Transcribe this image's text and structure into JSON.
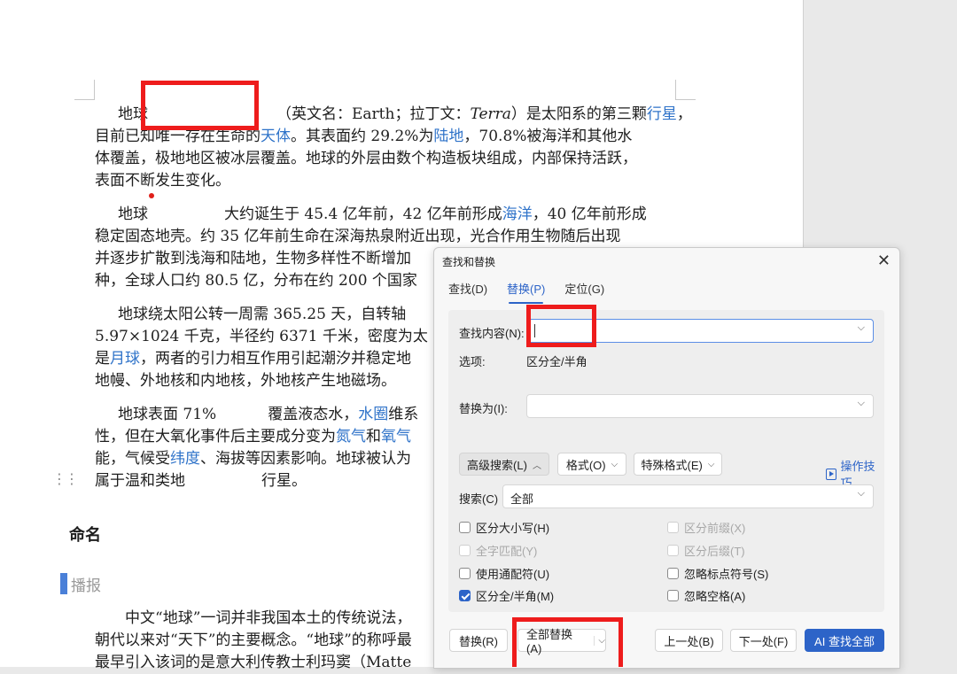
{
  "document": {
    "para1": [
      {
        "pre": "地球",
        "mid": "（英文名：Earth；拉丁文：",
        "italic": "Terra",
        "post": "）是太阳系的第三颗",
        "link": "行星",
        "end": "，"
      },
      {
        "a": "目前已知唯一存在生命的",
        "link": "天体",
        "b": "。其表面约 29.2%为",
        "link2": "陆地",
        "c": "，70.8%被海洋和其他水"
      },
      {
        "text": "体覆盖，极地地区被冰层覆盖。地球的外层由数个构造板块组成，内部保持活跃，"
      },
      {
        "text": "表面不断发生变化。"
      }
    ],
    "para2": [
      {
        "pre": "地球",
        "a": "大约诞生于 45.4 亿年前，42 亿年前形成",
        "link": "海洋",
        "b": "，40 亿年前形成"
      },
      {
        "text": "稳定固态地壳。约 35 亿年前生命在深海热泉附近出现，光合作用生物随后出现"
      },
      {
        "text": "并逐步扩散到浅海和陆地，生物多样性不断增加"
      },
      {
        "text": "种，全球人口约 80.5 亿，分布在约 200 个国家"
      }
    ],
    "para3": [
      {
        "text": "地球绕太阳公转一周需 365.25 天，自转轴"
      },
      {
        "text": "5.97×1024 千克，半径约 6371 千米，密度为太"
      },
      {
        "a": "是",
        "link": "月球",
        "b": "，两者的引力相互作用引起潮汐并稳定地"
      },
      {
        "text": "地幔、外地核和内地核，外地核产生地磁场。"
      }
    ],
    "para4": [
      {
        "a": "地球表面 71%",
        "b": "覆盖液态水，",
        "link": "水圈",
        "c": "维系"
      },
      {
        "a": "性，但在大氧化事件后主要成分变为",
        "link": "氮气",
        "b": "和",
        "link2": "氧气"
      },
      {
        "a": "能，气候受",
        "link": "纬度",
        "b": "、海拔等因素影响。地球被认为"
      },
      {
        "a": "属于温和类地",
        "b": "行星。"
      }
    ],
    "heading": "命名",
    "broadcast": "播报",
    "para5": [
      {
        "text": "中文“地球”一词并非我国本土的传统说法，"
      },
      {
        "text": "朝代以来对“天下”的主要概念。“地球”的称呼最"
      },
      {
        "text": "最早引入该词的是意大利传教士利玛窦（Matte"
      }
    ]
  },
  "dialog": {
    "title": "查找和替换",
    "close": "✕",
    "tabs": [
      {
        "label": "查找(D)"
      },
      {
        "label": "替换(P)"
      },
      {
        "label": "定位(G)"
      }
    ],
    "find_label": "查找内容(N):",
    "find_value": "",
    "options_label": "选项:",
    "options_value": "区分全/半角",
    "replace_label": "替换为(I):",
    "replace_value": "",
    "advanced_btn": "高级搜索(L)",
    "format_btn": "格式(O)",
    "special_btn": "特殊格式(E)",
    "tips": "操作技巧",
    "search_label": "搜索(C)",
    "search_value": "全部",
    "checkboxes": {
      "case": "区分大小写(H)",
      "prefix": "区分前缀(X)",
      "whole": "全字匹配(Y)",
      "suffix": "区分后缀(T)",
      "wildcard": "使用通配符(U)",
      "punct": "忽略标点符号(S)",
      "width": "区分全/半角(M)",
      "space": "忽略空格(A)"
    },
    "replace_btn": "替换(R)",
    "replace_all_btn": "全部替换(A)",
    "prev_btn": "上一处(B)",
    "next_btn": "下一处(F)",
    "ai_btn": "AI 查找全部"
  },
  "icons": {
    "chevron": "chevron-down-icon",
    "tips": "play-box-icon",
    "drag": "drag-handle-icon"
  },
  "colors": {
    "accent": "#2d64c8",
    "link": "#2f73c9",
    "highlight_box": "#ee1c1c"
  }
}
